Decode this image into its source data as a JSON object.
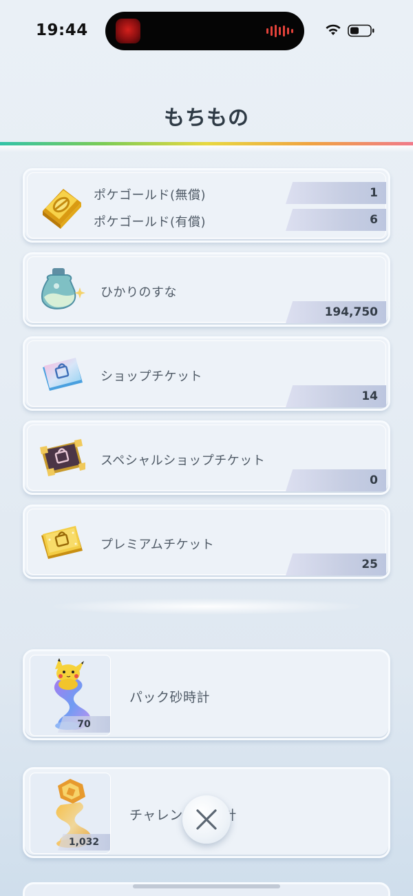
{
  "status_bar": {
    "time": "19:44"
  },
  "header": {
    "title": "もちもの"
  },
  "items": [
    {
      "icon": "gold-bar-icon",
      "rows": [
        {
          "label": "ポケゴールド(無償)",
          "count": "1"
        },
        {
          "label": "ポケゴールド(有償)",
          "count": "6"
        }
      ]
    },
    {
      "icon": "shining-sand-bottle-icon",
      "label": "ひかりのすな",
      "count": "194,750"
    },
    {
      "icon": "shop-ticket-icon",
      "label": "ショップチケット",
      "count": "14"
    },
    {
      "icon": "special-shop-ticket-icon",
      "label": "スペシャルショップチケット",
      "count": "0"
    },
    {
      "icon": "premium-ticket-icon",
      "label": "プレミアムチケット",
      "count": "25"
    }
  ],
  "hourglasses": [
    {
      "icon": "pack-hourglass-icon",
      "label": "パック砂時計",
      "count": "70"
    },
    {
      "icon": "challenge-hourglass-icon",
      "label": "チャレンジ砂時計",
      "count": "1,032"
    }
  ],
  "colors": {
    "accent_text": "#2e3a45",
    "badge": "#c6cde2",
    "card_bg": "#edf2f8"
  }
}
